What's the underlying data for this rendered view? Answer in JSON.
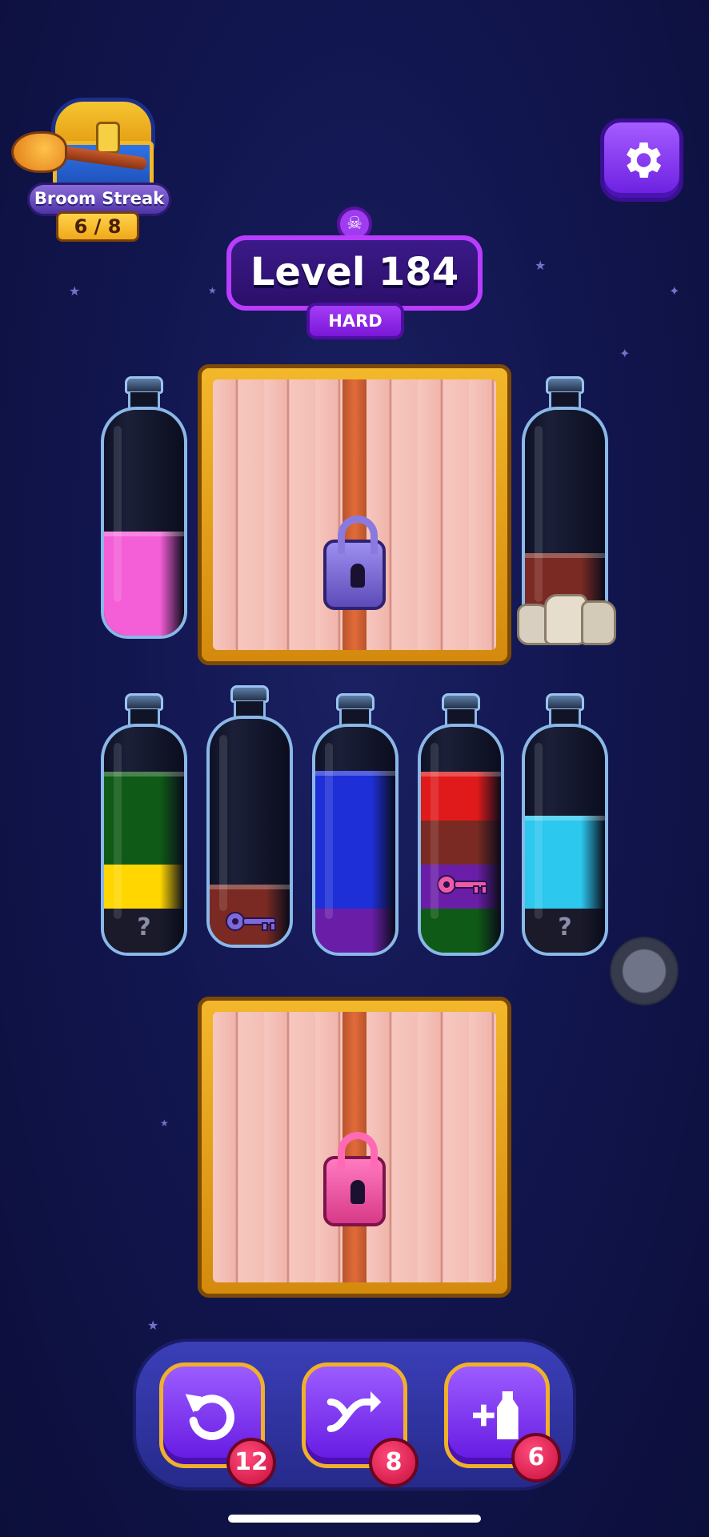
{
  "streak": {
    "title": "Broom Streak",
    "count": "6 / 8"
  },
  "level": {
    "label": "Level 184",
    "difficulty": "HARD"
  },
  "bottles": [
    {
      "id": "b1",
      "layers": [
        {
          "color": "#f45ed6",
          "height": 0.45
        }
      ],
      "mystery": false
    },
    {
      "id": "b2",
      "layers": [
        {
          "color": "#7a2a22",
          "height": 0.35
        }
      ],
      "mystery": false,
      "note": "rocks-blocked"
    },
    {
      "id": "b3",
      "layers": [
        {
          "color": "#1a1a2a",
          "height": 0.2
        },
        {
          "color": "#ffd600",
          "height": 0.2
        },
        {
          "color": "#0f5a16",
          "height": 0.4
        }
      ],
      "mystery": true
    },
    {
      "id": "b4",
      "layers": [
        {
          "color": "#7a2a22",
          "height": 0.25
        }
      ],
      "mystery": false,
      "key": true
    },
    {
      "id": "b5",
      "layers": [
        {
          "color": "#6a1ea8",
          "height": 0.2
        },
        {
          "color": "#1e2fd8",
          "height": 0.6
        }
      ],
      "mystery": false
    },
    {
      "id": "b6",
      "layers": [
        {
          "color": "#0f5a16",
          "height": 0.2
        },
        {
          "color": "#6a1ea8",
          "height": 0.2
        },
        {
          "color": "#7a2a22",
          "height": 0.2
        },
        {
          "color": "#e01a1a",
          "height": 0.2
        }
      ],
      "mystery": false,
      "key": true
    },
    {
      "id": "b7",
      "layers": [
        {
          "color": "#1a1a2a",
          "height": 0.2
        },
        {
          "color": "#2cc8ee",
          "height": 0.4
        }
      ],
      "mystery": true
    }
  ],
  "mystery_mark": "?",
  "crates": [
    {
      "lock_color": "#7b6ad8"
    },
    {
      "lock_color": "#ee5aa8"
    }
  ],
  "boosters": {
    "undo_count": "12",
    "shuffle_count": "8",
    "add_bottle_count": "6"
  },
  "icons": [
    "broom-chest-icon",
    "gear-icon",
    "skull-icon",
    "undo-icon",
    "shuffle-icon",
    "add-bottle-icon",
    "padlock-icon",
    "key-icon"
  ]
}
